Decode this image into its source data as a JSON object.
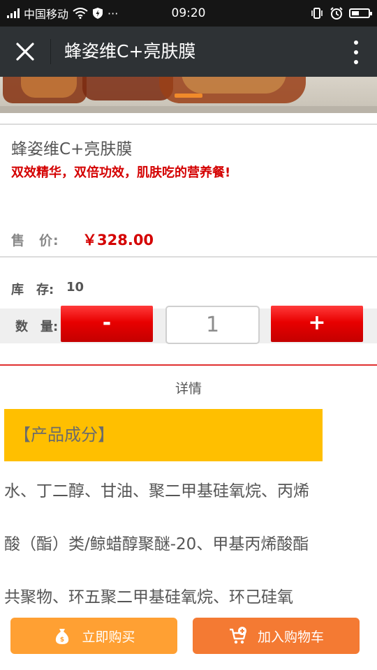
{
  "status_bar": {
    "carrier": "中国移动",
    "time": "09:20",
    "more": "···"
  },
  "nav": {
    "title": "蜂姿维C+亮肤膜"
  },
  "product": {
    "name": "蜂姿维C+亮肤膜",
    "slogan": "双效精华，双倍功效，肌肤吃的营养餐!",
    "price_label": "售　价:",
    "price": "￥328.00",
    "stock_label": "库　存:",
    "stock": "10",
    "quantity_label": "数　量:",
    "quantity": "1",
    "minus_label": "-",
    "plus_label": "+"
  },
  "detail": {
    "heading": "详情",
    "ingredients_tag": "【产品成分】",
    "lines": [
      "水、丁二醇、甘油、聚二甲基硅氧烷、丙烯",
      "酸（酯）类/鲸蜡醇聚醚-20、甲基丙烯酸酯",
      "共聚物、环五聚二甲基硅氧烷、环己硅氧"
    ]
  },
  "actions": {
    "buy_now": "立即购买",
    "add_to_cart": "加入购物车"
  },
  "icons": {
    "close": "close-icon",
    "more": "more-vertical-icon",
    "buy": "money-bag-icon",
    "cart": "cart-add-icon"
  },
  "colors": {
    "nav_bg": "#2e3235",
    "price_red": "#d40000",
    "stepper_red": "#e80000",
    "tag_yellow": "#ffbf00",
    "buy_orange": "#ffa033",
    "cart_orange": "#f47a33"
  }
}
